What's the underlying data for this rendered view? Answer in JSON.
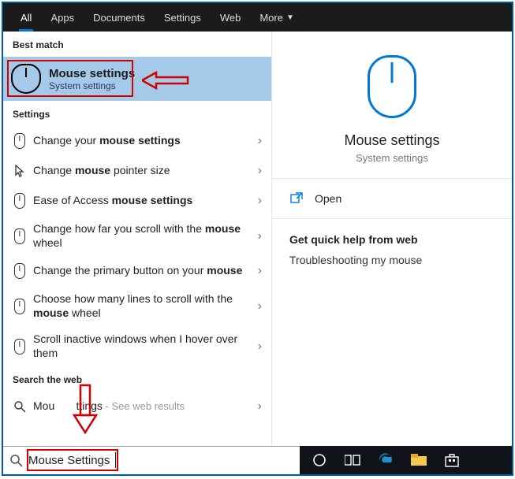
{
  "tabs": {
    "all": "All",
    "apps": "Apps",
    "documents": "Documents",
    "settings": "Settings",
    "web": "Web",
    "more": "More"
  },
  "sections": {
    "best_match": "Best match",
    "settings": "Settings",
    "search_web": "Search the web"
  },
  "best_match": {
    "title": "Mouse settings",
    "subtitle": "System settings"
  },
  "settings_items": {
    "i1_pre": "Change your ",
    "i1_bold": "mouse settings",
    "i2_pre": "Change ",
    "i2_bold": "mouse",
    "i2_post": " pointer size",
    "i3_pre": "Ease of Access ",
    "i3_bold": "mouse settings",
    "i4_pre": "Change how far you scroll with the ",
    "i4_bold": "mouse",
    "i4_post": " wheel",
    "i5_pre": "Change the primary button on your ",
    "i5_bold": "mouse",
    "i6_pre": "Choose how many lines to scroll with the ",
    "i6_bold": "mouse",
    "i6_post": " wheel",
    "i7": "Scroll inactive windows when I hover over them"
  },
  "web_item": {
    "pre": "Mou",
    "bold": "",
    "mid": "       ttings",
    "hint": " - See web results"
  },
  "right": {
    "title": "Mouse settings",
    "subtitle": "System settings",
    "open": "Open",
    "help_header": "Get quick help from web",
    "help_link": "Troubleshooting my mouse"
  },
  "search": {
    "value": "Mouse Settings"
  }
}
